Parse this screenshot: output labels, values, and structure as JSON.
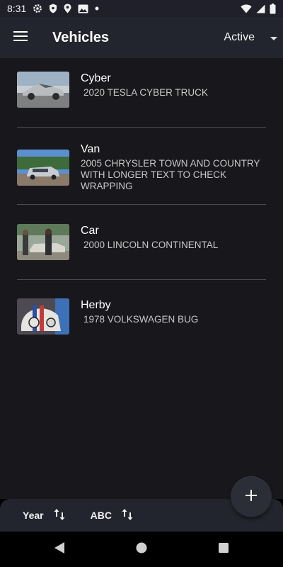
{
  "status_bar": {
    "time": "8:31"
  },
  "app_bar": {
    "title": "Vehicles",
    "filter_value": "Active"
  },
  "vehicles": [
    {
      "name": "Cyber",
      "description": "2020 TESLA CYBER TRUCK"
    },
    {
      "name": "Van",
      "description": "2005 CHRYSLER TOWN AND COUNTRY WITH LONGER TEXT TO CHECK WRAPPING"
    },
    {
      "name": "Car",
      "description": "2000 LINCOLN CONTINENTAL"
    },
    {
      "name": "Herby",
      "description": "1978 VOLKSWAGEN BUG"
    }
  ],
  "sort_bar": {
    "year_label": "Year",
    "abc_label": "ABC"
  },
  "colors": {
    "app_bar": "#23252e",
    "background": "#18181c",
    "status_bar": "#1f2029"
  }
}
